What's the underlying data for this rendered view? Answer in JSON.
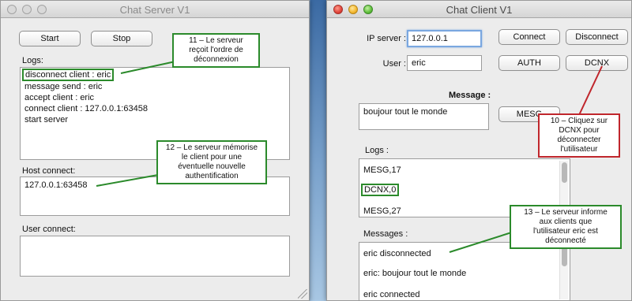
{
  "server": {
    "title": "Chat Server V1",
    "start_label": "Start",
    "stop_label": "Stop",
    "logs_label": "Logs:",
    "logs": [
      "disconnect client : eric",
      "message send : eric",
      "accept client : eric",
      "connect client : 127.0.0.1:63458",
      "start server"
    ],
    "host_label": "Host connect:",
    "hosts": [
      "127.0.0.1:63458"
    ],
    "user_label": "User connect:"
  },
  "client": {
    "title": "Chat Client V1",
    "ip_label": "IP server :",
    "ip_value": "127.0.0.1",
    "user_label": "User :",
    "user_value": "eric",
    "connect_label": "Connect",
    "disconnect_label": "Disconnect",
    "auth_label": "AUTH",
    "dcnx_label": "DCNX",
    "message_label": "Message :",
    "message_value": "boujour tout le monde",
    "mesg_label": "MESG",
    "logs_label": "Logs :",
    "logs": [
      "MESG,17",
      "DCNX,0",
      "MESG,27"
    ],
    "messages_label": "Messages :",
    "messages": [
      "eric disconnected",
      "eric: boujour tout le monde",
      "eric connected"
    ]
  },
  "annotations": {
    "note_11": "11 – Le serveur\nreçoit l'ordre de\ndéconnexion",
    "note_12": "12 – Le serveur mémorise\nle client pour une\néventuelle nouvelle\nauthentification",
    "note_10": "10 – Cliquez sur\nDCNX pour\ndéconnecter\nl'utilisateur",
    "note_13": "13 – Le serveur informe\naux clients que\nl'utilisateur eric est\ndéconnecté"
  },
  "colors": {
    "annotation_green": "#2b8a2b",
    "annotation_red": "#c0262c"
  }
}
